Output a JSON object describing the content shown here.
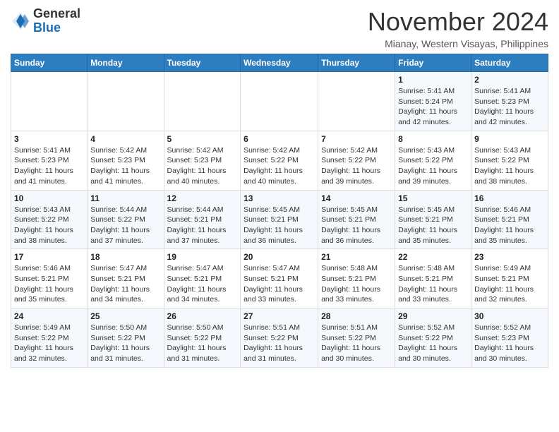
{
  "header": {
    "logo_general": "General",
    "logo_blue": "Blue",
    "month_title": "November 2024",
    "location": "Mianay, Western Visayas, Philippines"
  },
  "weekdays": [
    "Sunday",
    "Monday",
    "Tuesday",
    "Wednesday",
    "Thursday",
    "Friday",
    "Saturday"
  ],
  "weeks": [
    [
      {
        "day": "",
        "info": ""
      },
      {
        "day": "",
        "info": ""
      },
      {
        "day": "",
        "info": ""
      },
      {
        "day": "",
        "info": ""
      },
      {
        "day": "",
        "info": ""
      },
      {
        "day": "1",
        "info": "Sunrise: 5:41 AM\nSunset: 5:24 PM\nDaylight: 11 hours and 42 minutes."
      },
      {
        "day": "2",
        "info": "Sunrise: 5:41 AM\nSunset: 5:23 PM\nDaylight: 11 hours and 42 minutes."
      }
    ],
    [
      {
        "day": "3",
        "info": "Sunrise: 5:41 AM\nSunset: 5:23 PM\nDaylight: 11 hours and 41 minutes."
      },
      {
        "day": "4",
        "info": "Sunrise: 5:42 AM\nSunset: 5:23 PM\nDaylight: 11 hours and 41 minutes."
      },
      {
        "day": "5",
        "info": "Sunrise: 5:42 AM\nSunset: 5:23 PM\nDaylight: 11 hours and 40 minutes."
      },
      {
        "day": "6",
        "info": "Sunrise: 5:42 AM\nSunset: 5:22 PM\nDaylight: 11 hours and 40 minutes."
      },
      {
        "day": "7",
        "info": "Sunrise: 5:42 AM\nSunset: 5:22 PM\nDaylight: 11 hours and 39 minutes."
      },
      {
        "day": "8",
        "info": "Sunrise: 5:43 AM\nSunset: 5:22 PM\nDaylight: 11 hours and 39 minutes."
      },
      {
        "day": "9",
        "info": "Sunrise: 5:43 AM\nSunset: 5:22 PM\nDaylight: 11 hours and 38 minutes."
      }
    ],
    [
      {
        "day": "10",
        "info": "Sunrise: 5:43 AM\nSunset: 5:22 PM\nDaylight: 11 hours and 38 minutes."
      },
      {
        "day": "11",
        "info": "Sunrise: 5:44 AM\nSunset: 5:22 PM\nDaylight: 11 hours and 37 minutes."
      },
      {
        "day": "12",
        "info": "Sunrise: 5:44 AM\nSunset: 5:21 PM\nDaylight: 11 hours and 37 minutes."
      },
      {
        "day": "13",
        "info": "Sunrise: 5:45 AM\nSunset: 5:21 PM\nDaylight: 11 hours and 36 minutes."
      },
      {
        "day": "14",
        "info": "Sunrise: 5:45 AM\nSunset: 5:21 PM\nDaylight: 11 hours and 36 minutes."
      },
      {
        "day": "15",
        "info": "Sunrise: 5:45 AM\nSunset: 5:21 PM\nDaylight: 11 hours and 35 minutes."
      },
      {
        "day": "16",
        "info": "Sunrise: 5:46 AM\nSunset: 5:21 PM\nDaylight: 11 hours and 35 minutes."
      }
    ],
    [
      {
        "day": "17",
        "info": "Sunrise: 5:46 AM\nSunset: 5:21 PM\nDaylight: 11 hours and 35 minutes."
      },
      {
        "day": "18",
        "info": "Sunrise: 5:47 AM\nSunset: 5:21 PM\nDaylight: 11 hours and 34 minutes."
      },
      {
        "day": "19",
        "info": "Sunrise: 5:47 AM\nSunset: 5:21 PM\nDaylight: 11 hours and 34 minutes."
      },
      {
        "day": "20",
        "info": "Sunrise: 5:47 AM\nSunset: 5:21 PM\nDaylight: 11 hours and 33 minutes."
      },
      {
        "day": "21",
        "info": "Sunrise: 5:48 AM\nSunset: 5:21 PM\nDaylight: 11 hours and 33 minutes."
      },
      {
        "day": "22",
        "info": "Sunrise: 5:48 AM\nSunset: 5:21 PM\nDaylight: 11 hours and 33 minutes."
      },
      {
        "day": "23",
        "info": "Sunrise: 5:49 AM\nSunset: 5:21 PM\nDaylight: 11 hours and 32 minutes."
      }
    ],
    [
      {
        "day": "24",
        "info": "Sunrise: 5:49 AM\nSunset: 5:22 PM\nDaylight: 11 hours and 32 minutes."
      },
      {
        "day": "25",
        "info": "Sunrise: 5:50 AM\nSunset: 5:22 PM\nDaylight: 11 hours and 31 minutes."
      },
      {
        "day": "26",
        "info": "Sunrise: 5:50 AM\nSunset: 5:22 PM\nDaylight: 11 hours and 31 minutes."
      },
      {
        "day": "27",
        "info": "Sunrise: 5:51 AM\nSunset: 5:22 PM\nDaylight: 11 hours and 31 minutes."
      },
      {
        "day": "28",
        "info": "Sunrise: 5:51 AM\nSunset: 5:22 PM\nDaylight: 11 hours and 30 minutes."
      },
      {
        "day": "29",
        "info": "Sunrise: 5:52 AM\nSunset: 5:22 PM\nDaylight: 11 hours and 30 minutes."
      },
      {
        "day": "30",
        "info": "Sunrise: 5:52 AM\nSunset: 5:23 PM\nDaylight: 11 hours and 30 minutes."
      }
    ]
  ]
}
